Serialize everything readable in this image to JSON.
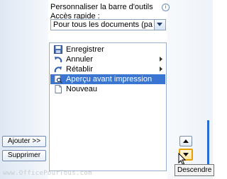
{
  "header": {
    "title": "Personnaliser la barre d'outils Accès rapide :"
  },
  "scope_select": {
    "value": "Pour tous les documents (par dé..."
  },
  "commands": [
    {
      "label": "Enregistrer",
      "icon": "save-icon",
      "has_submenu": false
    },
    {
      "label": "Annuler",
      "icon": "undo-icon",
      "has_submenu": true
    },
    {
      "label": "Rétablir",
      "icon": "redo-icon",
      "has_submenu": true
    },
    {
      "label": "Aperçu avant impression",
      "icon": "print-preview-icon",
      "has_submenu": false,
      "selected": true
    },
    {
      "label": "Nouveau",
      "icon": "new-document-icon",
      "has_submenu": false
    }
  ],
  "buttons": {
    "add": "Ajouter >>",
    "remove": "Supprimer"
  },
  "tooltip": "Descendre",
  "watermark": "www.OfficePourTous.com",
  "colors": {
    "selection": "#3a76d1",
    "accent_border": "#e8a000"
  }
}
